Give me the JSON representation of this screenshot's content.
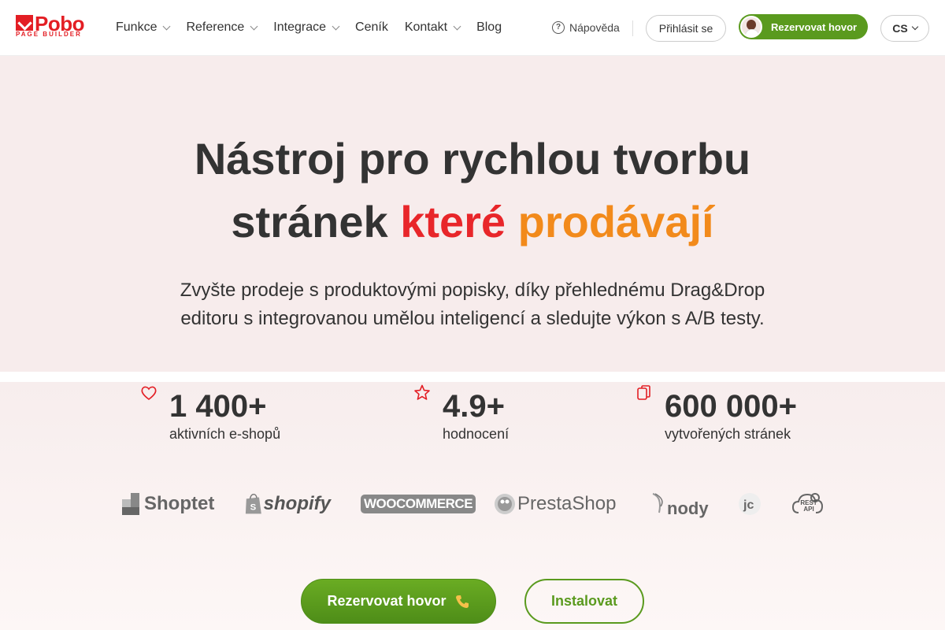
{
  "header": {
    "logo_text": "Pobo",
    "logo_sub": "PAGE BUILDER",
    "nav": [
      {
        "label": "Funkce",
        "has_dropdown": true
      },
      {
        "label": "Reference",
        "has_dropdown": true
      },
      {
        "label": "Integrace",
        "has_dropdown": true
      },
      {
        "label": "Ceník",
        "has_dropdown": false
      },
      {
        "label": "Kontakt",
        "has_dropdown": true
      },
      {
        "label": "Blog",
        "has_dropdown": false
      }
    ],
    "help_label": "Nápověda",
    "login_label": "Přihlásit se",
    "book_call_label": "Rezervovat hovor",
    "lang_label": "CS"
  },
  "hero": {
    "title_line1": "Nástroj pro rychlou tvorbu",
    "title_line2_start": "stránek",
    "title_highlight_red": "které",
    "title_highlight_orange": "prodávají",
    "subtitle_line1": "Zvyšte prodeje s produktovými popisky, díky přehlednému Drag&Drop",
    "subtitle_line2": "editoru s integrovanou umělou inteligencí a sledujte výkon s A/B testy."
  },
  "stats": [
    {
      "icon": "heart-icon",
      "value": "1 400+",
      "label": "aktivních e-shopů"
    },
    {
      "icon": "star-icon",
      "value": "4.9+",
      "label": "hodnocení"
    },
    {
      "icon": "pages-icon",
      "value": "600 000+",
      "label": "vytvořených stránek"
    }
  ],
  "integrations": [
    "Shoptet",
    "shopify",
    "WOOCOMMERCE",
    "PrestaShop",
    "nody",
    "REST API"
  ],
  "cta": {
    "primary_label": "Rezervovat hovor",
    "secondary_label": "Instalovat"
  },
  "colors": {
    "brand_red": "#e31e24",
    "accent_green": "#5a9a1e",
    "highlight_orange": "#f28a1b",
    "hero_bg": "#f7ecec"
  }
}
